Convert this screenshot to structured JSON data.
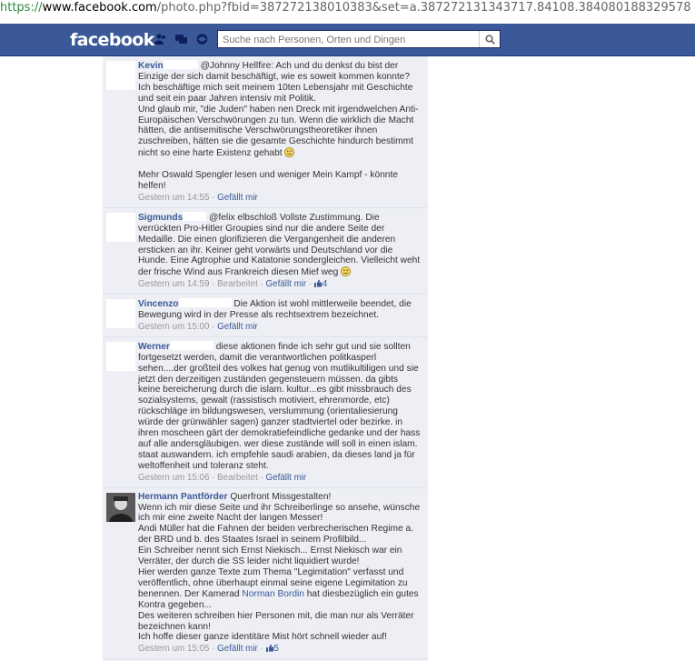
{
  "browser": {
    "url_scheme": "https://",
    "url_host": "www.facebook.com",
    "url_rest": "/photo.php?fbid=387272138010383&set=a.387272131343717.84108.384080188329578"
  },
  "header": {
    "logo": "facebook",
    "search_placeholder": "Suche nach Personen, Orten und Dingen",
    "brand_color": "#3b5998"
  },
  "comments": [
    {
      "name": "Kevin",
      "text": "@Johnny Hellfire: Ach und du denkst du bist der Einzige der sich damit beschäftigt, wie es soweit kommen konnte? Ich beschäftige mich seit meinem 10ten Lebensjahr mit Geschichte und seit ein paar Jahren intensiv mit Politik.\nUnd glaub mir, \"die Juden\" haben nen Dreck mit irgendwelchen Anti-Europäischen Verschwörungen zu tun. Wenn die wirklich die Macht hätten, die antisemitische Verschwörungstheoretiker ihnen zuschreiben, hätten sie die gesamte Geschichte hindurch bestimmt nicht so eine harte Existenz gehabt",
      "text2": "\n\nMehr Oswald Spengler lesen und weniger Mein Kampf - könnte helfen!",
      "time": "Gestern um 14:55",
      "like": "Gefällt mir"
    },
    {
      "name": "Sigmunds",
      "text": "@felix elbschloß Vollste Zustimmung. Die verrückten Pro-Hitler Groupies sind nur die andere Seite der Medaille. Die einen glorifizieren die Vergangenheit die anderen ersticken an ihr. Keiner geht vorwärts und Deutschland vor die Hunde. Eine Agtrophie und Katatonie sondergleichen. Vielleicht weht der frische Wind aus Frankreich diesen Mief weg",
      "time": "Gestern um 14:59",
      "edited": "Bearbeitet",
      "like": "Gefällt mir",
      "likes": "4"
    },
    {
      "name": "Vincenzo",
      "text": "Die Aktion ist wohl mittlerweile beendet, die Bewegung wird in der Presse als rechtsextrem bezeichnet.",
      "time": "Gestern um 15:00",
      "like": "Gefällt mir"
    },
    {
      "name": "Werner",
      "text": "diese aktionen finde ich sehr gut und sie sollten fortgesetzt werden, damit die verantwortlichen politkasperl sehen....der großteil des volkes hat genug von mutlikultiligen und sie jetzt den derzeitigen zuständen gegensteuern müssen. da gibts keine bereicherung durch die islam. kultur...es gibt missbrauch des sozialsystems, gewalt (rassistisch motiviert, ehrenmorde, etc) rückschläge im bildungswesen, verslummung (orientaliesierung würde der grünwähler sagen) ganzer stadtviertel oder bezirke. in ihren moscheen gärt der demokratiefeindliche gedanke und der hass auf alle andersgläubigen. wer diese zustände will soll in einen islam. staat auswandern. ich empfehle saudi arabien, da dieses land ja für weltoffenheit und toleranz steht.",
      "time": "Gestern um 15:06",
      "edited": "Bearbeitet",
      "like": "Gefällt mir"
    },
    {
      "name": "Hermann Pantförder",
      "text": "Querfront Missgestalten!\nWenn ich mir diese Seite und ihr Schreiberlinge so ansehe, wünsche ich mir eine zweite Nacht der langen Messer!\nAndi Müller hat die Fahnen der beiden verbrecherischen Regime a. der BRD und b. des Staates Israel in seinem Profilbild...\nEin Schreiber nennt sich Ernst Niekisch... Ernst Niekisch war ein Verräter, der durch die SS leider nicht liquidiert wurde!\nHier werden ganze Texte zum Thema \"Legimitation\" verfasst und veröffentlich, ohne überhaupt einmal seine eigene Legimitation zu benennen. Der Kamerad ",
      "mention": "Norman Bordin",
      "text2": " hat diesbezüglich ein gutes Kontra gegeben...\nDes weiteren schreiben hier Personen mit, die man nur als Verräter bezeichnen kann!\nIch hoffe dieser ganze identitäre Mist hört schnell wieder auf!",
      "time": "Gestern um 15:05",
      "like": "Gefällt mir",
      "likes": "5"
    }
  ],
  "separator": " · "
}
